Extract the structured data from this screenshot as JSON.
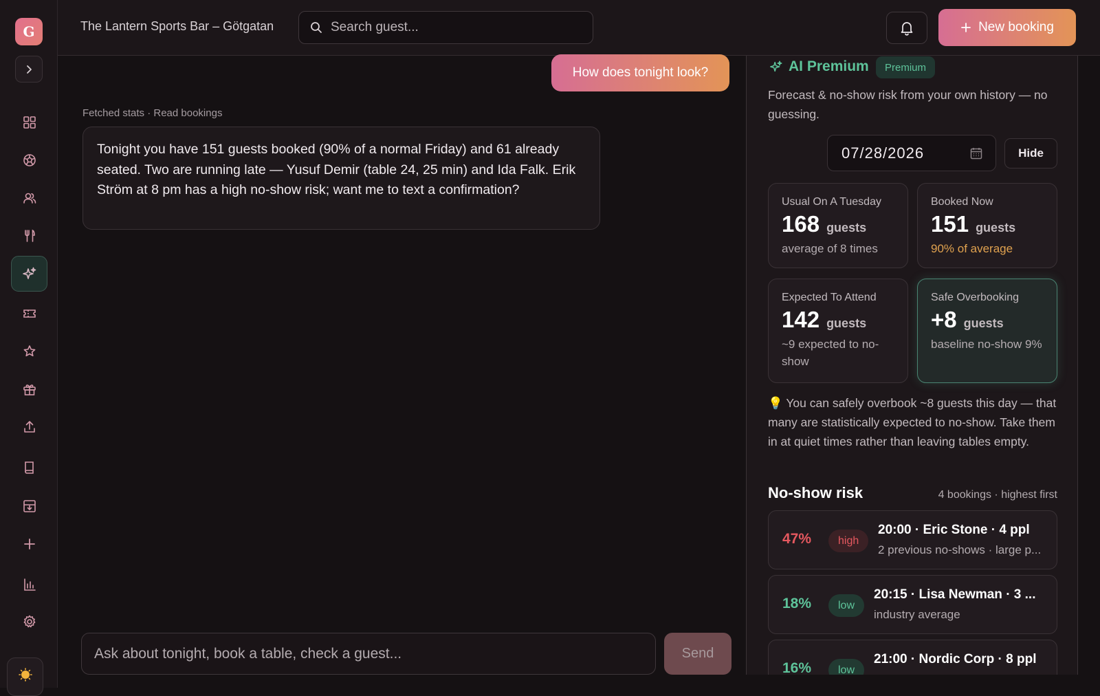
{
  "brand": {
    "logo_letter": "G"
  },
  "header": {
    "venue": "The Lantern Sports Bar – Götgatan",
    "search_placeholder": "Search guest...",
    "new_booking": "New booking"
  },
  "sidebar": {
    "items": [
      {
        "name": "dashboard",
        "icon": "grid-icon"
      },
      {
        "name": "floor",
        "icon": "soccer-ball-icon"
      },
      {
        "name": "guests",
        "icon": "users-icon"
      },
      {
        "name": "menu",
        "icon": "utensils-icon"
      },
      {
        "name": "ai",
        "icon": "sparkle-icon",
        "active": true
      },
      {
        "name": "tickets",
        "icon": "ticket-icon"
      },
      {
        "name": "reviews",
        "icon": "star-icon"
      },
      {
        "name": "gifts",
        "icon": "gift-icon"
      },
      {
        "name": "export",
        "icon": "upload-icon"
      },
      {
        "name": "book",
        "icon": "book-icon"
      },
      {
        "name": "inbox",
        "icon": "tray-icon"
      },
      {
        "name": "add",
        "icon": "plus-icon"
      },
      {
        "name": "analytics",
        "icon": "bar-chart-icon"
      },
      {
        "name": "settings",
        "icon": "gear-icon"
      }
    ]
  },
  "chat": {
    "user_message": "How does tonight look?",
    "tools_used": "Fetched stats · Read bookings",
    "assistant_message": "Tonight you have 151 guests booked (90% of a normal Friday) and 61 already seated. Two are running late — Yusuf Demir (table 24, 25 min) and Ida Falk. Erik Ström at 8 pm has a high no-show risk; want me to text a confirmation?",
    "composer_placeholder": "Ask about tonight, book a table, check a guest...",
    "send_label": "Send"
  },
  "panel": {
    "title": "AI Premium",
    "badge": "Premium",
    "description": "Forecast & no-show risk from your own history — no guessing.",
    "date": "07/28/2026",
    "hide_label": "Hide",
    "cards": [
      {
        "label": "Usual On A Tuesday",
        "value": "168",
        "unit": "guests",
        "sub": "average of 8 times"
      },
      {
        "label": "Booked Now",
        "value": "151",
        "unit": "guests",
        "sub": "90% of average"
      },
      {
        "label": "Expected To Attend",
        "value": "142",
        "unit": "guests",
        "sub": "~9 expected to no-show"
      },
      {
        "label": "Safe Overbooking",
        "value": "+8",
        "unit": "guests",
        "sub": "baseline no-show 9%"
      }
    ],
    "tip_icon": "💡",
    "tip": "You can safely overbook ~8 guests this day — that many are statistically expected to no-show. Take them in at quiet times rather than leaving tables empty.",
    "risk_title": "No-show risk",
    "risk_meta": "4 bookings · highest first",
    "risk_rows": [
      {
        "pct": "47%",
        "level": "high",
        "booking": "20:00 · Eric Stone · 4 ppl",
        "note": "2 previous no-shows · large p..."
      },
      {
        "pct": "18%",
        "level": "low",
        "booking": "20:15 · Lisa Newman · 3 ...",
        "note": "industry average"
      },
      {
        "pct": "16%",
        "level": "low",
        "booking": "21:00 · Nordic Corp · 8 ppl",
        "note": ""
      }
    ]
  },
  "colors": {
    "accent_green": "#5ec39a",
    "danger": "#e5585f",
    "warning": "#e0a24f",
    "gradient_start": "#d66e93",
    "gradient_end": "#e39457"
  }
}
